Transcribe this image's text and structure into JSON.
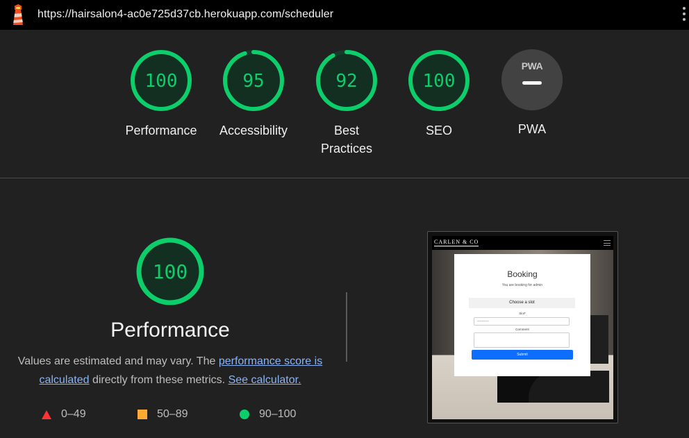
{
  "browser": {
    "url": "https://hairsalon4-ac0e725d37cb.herokuapp.com/scheduler"
  },
  "gauges": [
    {
      "score": "100",
      "label_line1": "Performance",
      "label_line2": "",
      "fraction": 1.0,
      "color": "#0cce6b"
    },
    {
      "score": "95",
      "label_line1": "Accessibility",
      "label_line2": "",
      "fraction": 0.95,
      "color": "#0cce6b"
    },
    {
      "score": "92",
      "label_line1": "Best",
      "label_line2": "Practices",
      "fraction": 0.92,
      "color": "#0cce6b"
    },
    {
      "score": "100",
      "label_line1": "SEO",
      "label_line2": "",
      "fraction": 1.0,
      "color": "#0cce6b"
    }
  ],
  "pwa": {
    "badge": "PWA",
    "label": "PWA"
  },
  "performance": {
    "score": "100",
    "fraction": 1.0,
    "title": "Performance",
    "desc_part1": "Values are estimated and may vary. The ",
    "desc_link1": "performance score is calculated",
    "desc_part2": " directly from these metrics. ",
    "desc_link2": "See calculator."
  },
  "legend": [
    {
      "shape": "triangle",
      "range": "0–49",
      "color": "#ff3333"
    },
    {
      "shape": "square",
      "range": "50–89",
      "color": "#ffaa33"
    },
    {
      "shape": "circle",
      "range": "90–100",
      "color": "#0cce6b"
    }
  ],
  "thumbnail": {
    "brand": "CARLEN & CO",
    "card_title": "Booking",
    "card_subtitle": "You are booking for admin",
    "slot_header": "Choose a slot",
    "slot_label": "Slot*",
    "slot_value": "----------",
    "comment_label": "Comment",
    "submit_label": "Submit"
  }
}
